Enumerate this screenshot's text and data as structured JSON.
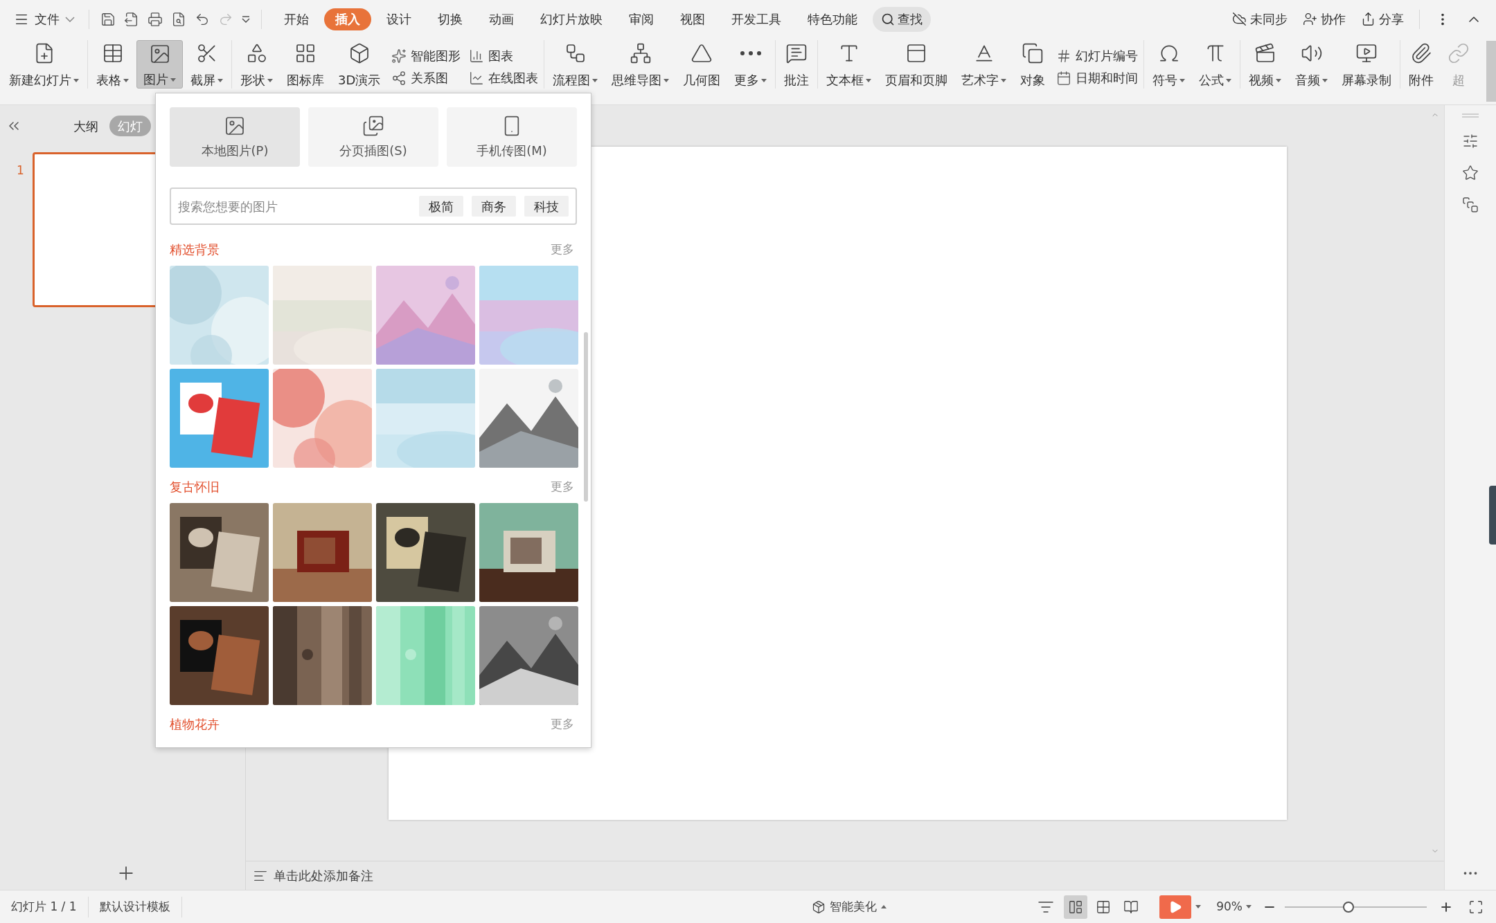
{
  "menu": {
    "file": "文件",
    "tabs": [
      {
        "label": "开始",
        "selected": false
      },
      {
        "label": "插入",
        "selected": true
      },
      {
        "label": "设计",
        "selected": false
      },
      {
        "label": "切换",
        "selected": false
      },
      {
        "label": "动画",
        "selected": false
      },
      {
        "label": "幻灯片放映",
        "selected": false
      },
      {
        "label": "审阅",
        "selected": false
      },
      {
        "label": "视图",
        "selected": false
      },
      {
        "label": "开发工具",
        "selected": false
      },
      {
        "label": "特色功能",
        "selected": false
      }
    ],
    "search": "查找"
  },
  "account": [
    {
      "label": "未同步"
    },
    {
      "label": "协作"
    },
    {
      "label": "分享"
    }
  ],
  "ribbon": [
    {
      "items": [
        {
          "kind": "large",
          "label": "新建幻灯片",
          "dropdown": true,
          "selected": false,
          "disabled": false
        }
      ]
    },
    {
      "items": [
        {
          "kind": "large",
          "label": "表格",
          "dropdown": true,
          "selected": false,
          "disabled": false
        },
        {
          "kind": "large",
          "label": "图片",
          "dropdown": true,
          "selected": true,
          "disabled": false
        },
        {
          "kind": "large",
          "label": "截屏",
          "dropdown": true,
          "selected": false,
          "disabled": false
        }
      ]
    },
    {
      "items": [
        {
          "kind": "large",
          "label": "形状",
          "dropdown": true,
          "selected": false,
          "disabled": false
        },
        {
          "kind": "large",
          "label": "图标库",
          "dropdown": false,
          "selected": false,
          "disabled": false
        },
        {
          "kind": "large",
          "label": "3D演示",
          "dropdown": false,
          "selected": false,
          "disabled": false
        },
        {
          "kind": "stack",
          "entries": [
            {
              "label": "智能图形"
            },
            {
              "label": "关系图"
            }
          ]
        },
        {
          "kind": "stack",
          "entries": [
            {
              "label": "图表"
            },
            {
              "label": "在线图表"
            }
          ]
        }
      ]
    },
    {
      "items": [
        {
          "kind": "large",
          "label": "流程图",
          "dropdown": true,
          "selected": false,
          "disabled": false
        },
        {
          "kind": "large",
          "label": "思维导图",
          "dropdown": true,
          "selected": false,
          "disabled": false
        },
        {
          "kind": "large",
          "label": "几何图",
          "dropdown": false,
          "selected": false,
          "disabled": false
        },
        {
          "kind": "large",
          "label": "更多",
          "dropdown": true,
          "selected": false,
          "disabled": false
        }
      ]
    },
    {
      "items": [
        {
          "kind": "large",
          "label": "批注",
          "dropdown": false,
          "selected": false,
          "disabled": false
        }
      ]
    },
    {
      "items": [
        {
          "kind": "large",
          "label": "文本框",
          "dropdown": true,
          "selected": false,
          "disabled": false
        },
        {
          "kind": "large",
          "label": "页眉和页脚",
          "dropdown": false,
          "selected": false,
          "disabled": false
        },
        {
          "kind": "large",
          "label": "艺术字",
          "dropdown": true,
          "selected": false,
          "disabled": false
        },
        {
          "kind": "large",
          "label": "对象",
          "dropdown": false,
          "selected": false,
          "disabled": false
        },
        {
          "kind": "stack",
          "entries": [
            {
              "label": "幻灯片编号"
            },
            {
              "label": "日期和时间"
            }
          ]
        }
      ]
    },
    {
      "items": [
        {
          "kind": "large",
          "label": "符号",
          "dropdown": true,
          "selected": false,
          "disabled": false
        },
        {
          "kind": "large",
          "label": "公式",
          "dropdown": true,
          "selected": false,
          "disabled": false
        }
      ]
    },
    {
      "items": [
        {
          "kind": "large",
          "label": "视频",
          "dropdown": true,
          "selected": false,
          "disabled": false
        },
        {
          "kind": "large",
          "label": "音频",
          "dropdown": true,
          "selected": false,
          "disabled": false
        },
        {
          "kind": "large",
          "label": "屏幕录制",
          "dropdown": false,
          "selected": false,
          "disabled": false
        }
      ]
    },
    {
      "items": [
        {
          "kind": "large",
          "label": "附件",
          "dropdown": false,
          "selected": false,
          "disabled": false
        },
        {
          "kind": "large",
          "label": "超",
          "dropdown": false,
          "selected": false,
          "disabled": true
        }
      ]
    }
  ],
  "left_panel": {
    "tabs": [
      {
        "label": "大纲",
        "selected": false
      },
      {
        "label": "幻灯",
        "selected": true
      }
    ],
    "slides": [
      {
        "number": "1",
        "selected": true
      }
    ]
  },
  "picture_menu": {
    "sources": [
      {
        "label": "本地图片(P)",
        "selected": true
      },
      {
        "label": "分页插图(S)",
        "selected": false
      },
      {
        "label": "手机传图(M)",
        "selected": false
      }
    ],
    "search": {
      "placeholder": "搜索您想要的图片",
      "tags": [
        "极简",
        "商务",
        "科技"
      ]
    },
    "sections": [
      {
        "title": "精选背景",
        "more": "更多"
      },
      {
        "title": "复古怀旧",
        "more": "更多"
      },
      {
        "title": "植物花卉",
        "more": "更多"
      }
    ]
  },
  "notes": {
    "placeholder": "单击此处添加备注"
  },
  "status_bar": {
    "slide": "幻灯片 1 / 1",
    "template": "默认设计模板",
    "beautify": "智能美化",
    "view_modes": [
      {
        "selected": true
      },
      {
        "selected": false
      },
      {
        "selected": false
      }
    ],
    "zoom": "90%",
    "zoom_slider": {
      "level": 0.45
    }
  }
}
